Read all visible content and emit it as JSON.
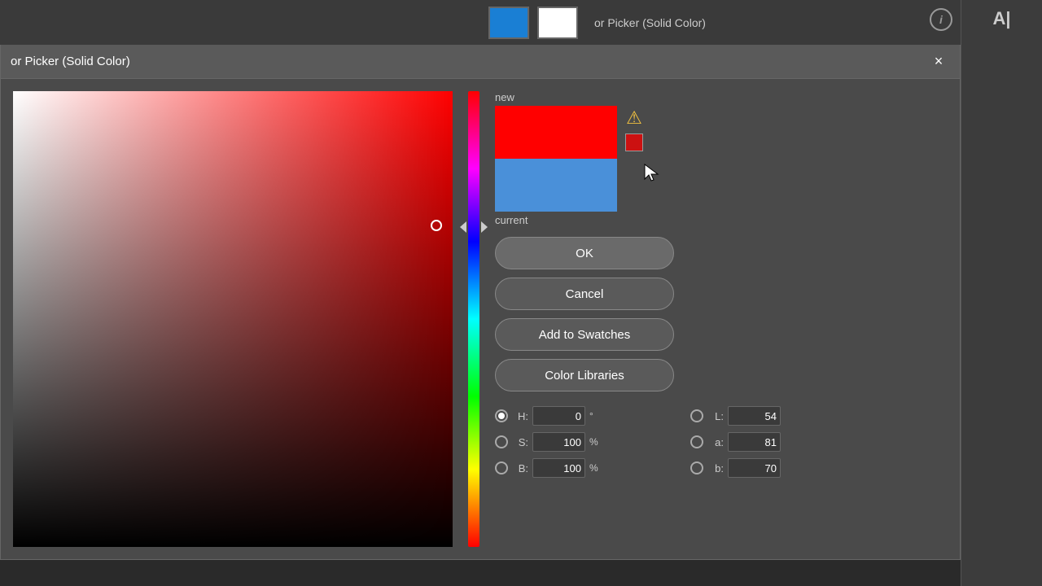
{
  "app": {
    "title": "or Picker (Solid Color)",
    "close_label": "×",
    "right_panel_label": "A|"
  },
  "toolbar": {
    "info_icon": "i"
  },
  "dialog": {
    "title": "or Picker (Solid Color)",
    "ok_label": "OK",
    "cancel_label": "Cancel",
    "add_swatches_label": "Add to Swatches",
    "color_libraries_label": "Color Libraries"
  },
  "swatches": {
    "new_label": "new",
    "current_label": "current",
    "new_color": "#ff0000",
    "current_color": "#4a90d9"
  },
  "color_values": {
    "h_label": "H:",
    "h_value": "0",
    "h_unit": "°",
    "s_label": "S:",
    "s_value": "100",
    "s_unit": "%",
    "b_label": "B:",
    "b_value": "100",
    "b_unit": "%",
    "l_label": "L:",
    "l_value": "54",
    "l_unit": "",
    "a_label": "a:",
    "a_value": "81",
    "a_unit": "",
    "b2_label": "b:",
    "b2_value": "70",
    "b2_unit": ""
  }
}
